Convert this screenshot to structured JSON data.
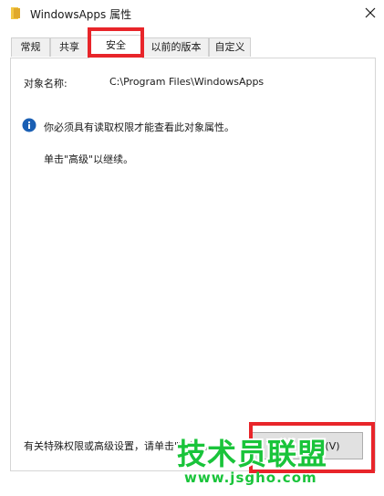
{
  "window": {
    "title": "WindowsApps 属性",
    "icons": {
      "app": "folder-icon",
      "close": "close-icon",
      "info": "info-icon"
    }
  },
  "tabs": [
    {
      "label": "常规",
      "active": false
    },
    {
      "label": "共享",
      "active": false
    },
    {
      "label": "安全",
      "active": true
    },
    {
      "label": "以前的版本",
      "active": false
    },
    {
      "label": "自定义",
      "active": false
    }
  ],
  "security": {
    "object_name_label": "对象名称:",
    "object_name_value": "C:\\Program Files\\WindowsApps",
    "info_message": "你必须具有读取权限才能查看此对象属性。",
    "continue_hint": "单击\"高级\"以继续。",
    "advanced_hint": "有关特殊权限或高级设置，请单击\"高级\"。",
    "advanced_button": "高级(V)"
  },
  "watermark": {
    "text": "技术员联盟",
    "url": "www.jsgho.com"
  },
  "colors": {
    "highlight": "#e8252a",
    "watermark": "#19c43a",
    "info_blue": "#1a5fb4",
    "folder_yellow": "#f2c744"
  }
}
